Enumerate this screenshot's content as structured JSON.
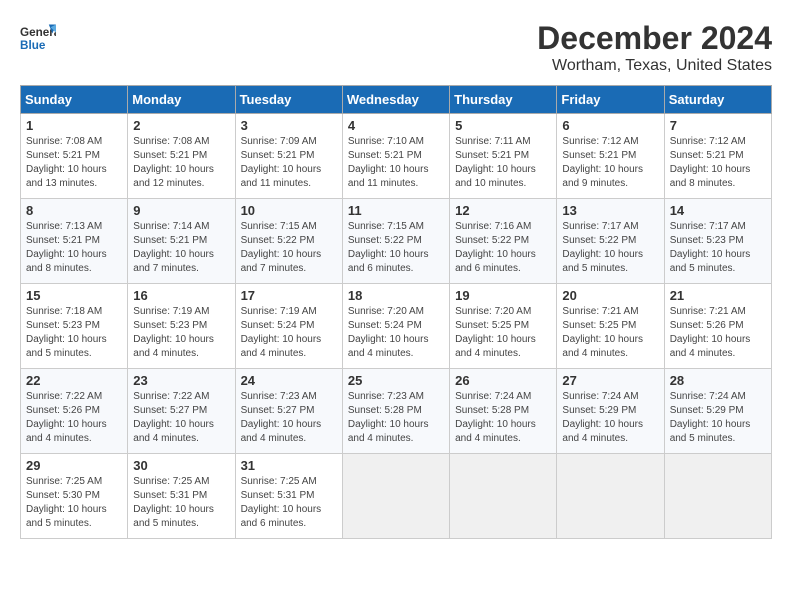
{
  "logo": {
    "line1": "General",
    "line2": "Blue"
  },
  "title": "December 2024",
  "location": "Wortham, Texas, United States",
  "days_of_week": [
    "Sunday",
    "Monday",
    "Tuesday",
    "Wednesday",
    "Thursday",
    "Friday",
    "Saturday"
  ],
  "weeks": [
    [
      {
        "day": "1",
        "info": "Sunrise: 7:08 AM\nSunset: 5:21 PM\nDaylight: 10 hours\nand 13 minutes."
      },
      {
        "day": "2",
        "info": "Sunrise: 7:08 AM\nSunset: 5:21 PM\nDaylight: 10 hours\nand 12 minutes."
      },
      {
        "day": "3",
        "info": "Sunrise: 7:09 AM\nSunset: 5:21 PM\nDaylight: 10 hours\nand 11 minutes."
      },
      {
        "day": "4",
        "info": "Sunrise: 7:10 AM\nSunset: 5:21 PM\nDaylight: 10 hours\nand 11 minutes."
      },
      {
        "day": "5",
        "info": "Sunrise: 7:11 AM\nSunset: 5:21 PM\nDaylight: 10 hours\nand 10 minutes."
      },
      {
        "day": "6",
        "info": "Sunrise: 7:12 AM\nSunset: 5:21 PM\nDaylight: 10 hours\nand 9 minutes."
      },
      {
        "day": "7",
        "info": "Sunrise: 7:12 AM\nSunset: 5:21 PM\nDaylight: 10 hours\nand 8 minutes."
      }
    ],
    [
      {
        "day": "8",
        "info": "Sunrise: 7:13 AM\nSunset: 5:21 PM\nDaylight: 10 hours\nand 8 minutes."
      },
      {
        "day": "9",
        "info": "Sunrise: 7:14 AM\nSunset: 5:21 PM\nDaylight: 10 hours\nand 7 minutes."
      },
      {
        "day": "10",
        "info": "Sunrise: 7:15 AM\nSunset: 5:22 PM\nDaylight: 10 hours\nand 7 minutes."
      },
      {
        "day": "11",
        "info": "Sunrise: 7:15 AM\nSunset: 5:22 PM\nDaylight: 10 hours\nand 6 minutes."
      },
      {
        "day": "12",
        "info": "Sunrise: 7:16 AM\nSunset: 5:22 PM\nDaylight: 10 hours\nand 6 minutes."
      },
      {
        "day": "13",
        "info": "Sunrise: 7:17 AM\nSunset: 5:22 PM\nDaylight: 10 hours\nand 5 minutes."
      },
      {
        "day": "14",
        "info": "Sunrise: 7:17 AM\nSunset: 5:23 PM\nDaylight: 10 hours\nand 5 minutes."
      }
    ],
    [
      {
        "day": "15",
        "info": "Sunrise: 7:18 AM\nSunset: 5:23 PM\nDaylight: 10 hours\nand 5 minutes."
      },
      {
        "day": "16",
        "info": "Sunrise: 7:19 AM\nSunset: 5:23 PM\nDaylight: 10 hours\nand 4 minutes."
      },
      {
        "day": "17",
        "info": "Sunrise: 7:19 AM\nSunset: 5:24 PM\nDaylight: 10 hours\nand 4 minutes."
      },
      {
        "day": "18",
        "info": "Sunrise: 7:20 AM\nSunset: 5:24 PM\nDaylight: 10 hours\nand 4 minutes."
      },
      {
        "day": "19",
        "info": "Sunrise: 7:20 AM\nSunset: 5:25 PM\nDaylight: 10 hours\nand 4 minutes."
      },
      {
        "day": "20",
        "info": "Sunrise: 7:21 AM\nSunset: 5:25 PM\nDaylight: 10 hours\nand 4 minutes."
      },
      {
        "day": "21",
        "info": "Sunrise: 7:21 AM\nSunset: 5:26 PM\nDaylight: 10 hours\nand 4 minutes."
      }
    ],
    [
      {
        "day": "22",
        "info": "Sunrise: 7:22 AM\nSunset: 5:26 PM\nDaylight: 10 hours\nand 4 minutes."
      },
      {
        "day": "23",
        "info": "Sunrise: 7:22 AM\nSunset: 5:27 PM\nDaylight: 10 hours\nand 4 minutes."
      },
      {
        "day": "24",
        "info": "Sunrise: 7:23 AM\nSunset: 5:27 PM\nDaylight: 10 hours\nand 4 minutes."
      },
      {
        "day": "25",
        "info": "Sunrise: 7:23 AM\nSunset: 5:28 PM\nDaylight: 10 hours\nand 4 minutes."
      },
      {
        "day": "26",
        "info": "Sunrise: 7:24 AM\nSunset: 5:28 PM\nDaylight: 10 hours\nand 4 minutes."
      },
      {
        "day": "27",
        "info": "Sunrise: 7:24 AM\nSunset: 5:29 PM\nDaylight: 10 hours\nand 4 minutes."
      },
      {
        "day": "28",
        "info": "Sunrise: 7:24 AM\nSunset: 5:29 PM\nDaylight: 10 hours\nand 5 minutes."
      }
    ],
    [
      {
        "day": "29",
        "info": "Sunrise: 7:25 AM\nSunset: 5:30 PM\nDaylight: 10 hours\nand 5 minutes."
      },
      {
        "day": "30",
        "info": "Sunrise: 7:25 AM\nSunset: 5:31 PM\nDaylight: 10 hours\nand 5 minutes."
      },
      {
        "day": "31",
        "info": "Sunrise: 7:25 AM\nSunset: 5:31 PM\nDaylight: 10 hours\nand 6 minutes."
      },
      null,
      null,
      null,
      null
    ]
  ]
}
